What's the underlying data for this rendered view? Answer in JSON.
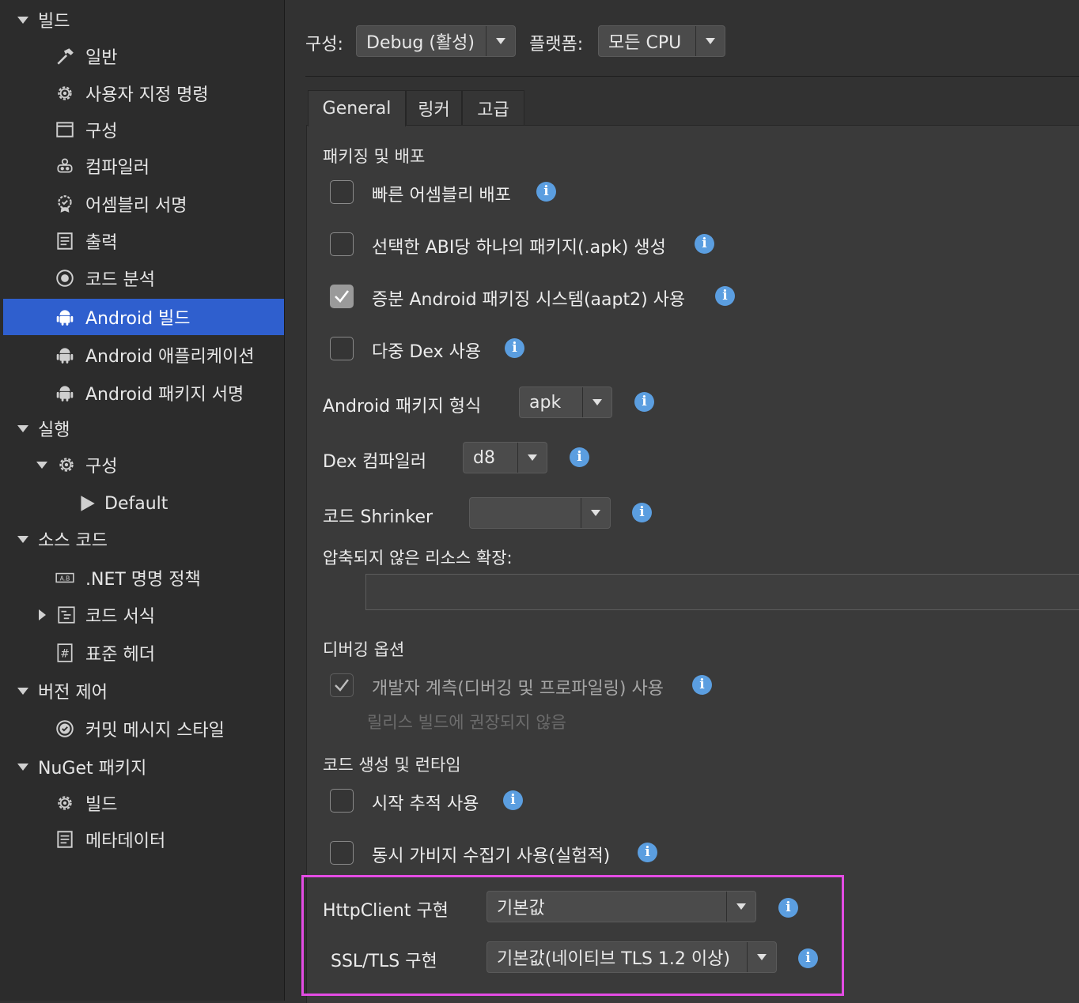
{
  "sidebar": {
    "items": [
      {
        "label": "빌드",
        "icon": "caret-down-icon"
      },
      {
        "label": "일반",
        "icon": "hammer-icon"
      },
      {
        "label": "사용자 지정 명령",
        "icon": "gear-icon"
      },
      {
        "label": "구성",
        "icon": "window-icon"
      },
      {
        "label": "컴파일러",
        "icon": "robot-gears-icon"
      },
      {
        "label": "어셈블리 서명",
        "icon": "seal-icon"
      },
      {
        "label": "출력",
        "icon": "document-icon"
      },
      {
        "label": "코드 분석",
        "icon": "target-icon"
      },
      {
        "label": "Android 빌드",
        "icon": "android-icon",
        "selected": true
      },
      {
        "label": "Android 애플리케이션",
        "icon": "android-icon"
      },
      {
        "label": "Android 패키지 서명",
        "icon": "android-icon"
      },
      {
        "label": "실행",
        "icon": "caret-down-icon"
      },
      {
        "label": "구성",
        "icon": "gear-icon"
      },
      {
        "label": "Default",
        "icon": "play-icon"
      },
      {
        "label": "소스 코드",
        "icon": "caret-down-icon"
      },
      {
        "label": ".NET 명명 정책",
        "icon": "naming-icon"
      },
      {
        "label": "코드 서식",
        "icon": "code-format-icon"
      },
      {
        "label": "표준 헤더",
        "icon": "hash-icon"
      },
      {
        "label": "버전 제어",
        "icon": "caret-down-icon"
      },
      {
        "label": "커밋 메시지 스타일",
        "icon": "check-circle-icon"
      },
      {
        "label": "NuGet 패키지",
        "icon": "caret-down-icon"
      },
      {
        "label": "빌드",
        "icon": "gear-icon"
      },
      {
        "label": "메타데이터",
        "icon": "document-icon"
      }
    ]
  },
  "toolbar": {
    "config_label": "구성:",
    "config_value": "Debug (활성)",
    "platform_label": "플랫폼:",
    "platform_value": "모든 CPU"
  },
  "tabs": [
    "General",
    "링커",
    "고급"
  ],
  "packaging": {
    "section": "패키징 및 배포",
    "options": [
      {
        "label": "빠른 어셈블리 배포",
        "checked": false
      },
      {
        "label": "선택한 ABI당 하나의 패키지(.apk) 생성",
        "checked": false
      },
      {
        "label": "증분 Android 패키징 시스템(aapt2) 사용",
        "checked": true
      },
      {
        "label": "다중 Dex 사용",
        "checked": false
      }
    ],
    "package_format_label": "Android 패키지 형식",
    "package_format_value": "apk",
    "dex_compiler_label": "Dex 컴파일러",
    "dex_compiler_value": "d8",
    "code_shrinker_label": "코드 Shrinker",
    "code_shrinker_value": "",
    "uncompressed_label": "압축되지 않은 리소스 확장:",
    "uncompressed_value": ""
  },
  "debugging": {
    "section": "디버깅 옵션",
    "instrumentation_label": "개발자 계측(디버깅 및 프로파일링) 사용",
    "instrumentation_checked": true,
    "instrumentation_hint": "릴리스 빌드에 권장되지 않음"
  },
  "codegen": {
    "section": "코드 생성 및 런타임",
    "options": [
      {
        "label": "시작 추적 사용",
        "checked": false
      },
      {
        "label": "동시 가비지 수집기 사용(실험적)",
        "checked": false
      }
    ],
    "httpclient_label": "HttpClient 구현",
    "httpclient_value": "기본값",
    "ssl_label": "SSL/TLS 구현",
    "ssl_value": "기본값(네이티브 TLS 1.2 이상)"
  },
  "info_icon_glyph": "i",
  "colors": {
    "selection": "#2f5fce",
    "info": "#5b9ee0",
    "highlight": "#e44ce4"
  }
}
